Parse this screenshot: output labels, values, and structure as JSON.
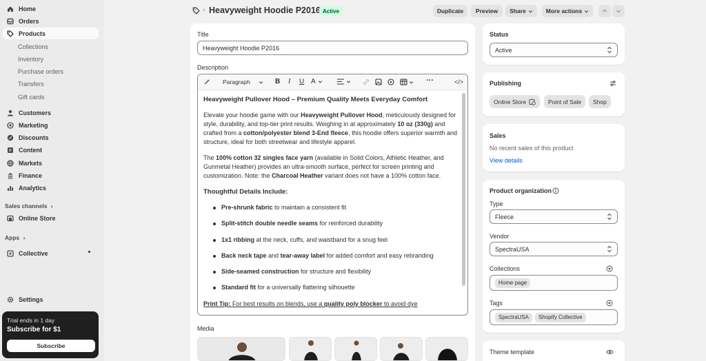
{
  "sidebar": {
    "items": [
      {
        "label": "Home",
        "icon": "home-icon"
      },
      {
        "label": "Orders",
        "icon": "orders-icon"
      },
      {
        "label": "Products",
        "icon": "tag-icon"
      },
      {
        "label": "Customers",
        "icon": "person-icon"
      },
      {
        "label": "Marketing",
        "icon": "target-icon"
      },
      {
        "label": "Discounts",
        "icon": "discount-icon"
      },
      {
        "label": "Content",
        "icon": "content-icon"
      },
      {
        "label": "Markets",
        "icon": "globe-icon"
      },
      {
        "label": "Finance",
        "icon": "bank-icon"
      },
      {
        "label": "Analytics",
        "icon": "chart-icon"
      }
    ],
    "product_subitems": [
      "Collections",
      "Inventory",
      "Purchase orders",
      "Transfers",
      "Gift cards"
    ],
    "sales_channels_label": "Sales channels",
    "online_store_label": "Online Store",
    "apps_label": "Apps",
    "collective_label": "Collective",
    "settings_label": "Settings",
    "trial": {
      "line1": "Trial ends in 1 day",
      "line2": "Subscribe for $1",
      "button": "Subscribe"
    }
  },
  "header": {
    "title": "Heavyweight Hoodie P2016",
    "status_badge": "Active",
    "buttons": {
      "duplicate": "Duplicate",
      "preview": "Preview",
      "share": "Share",
      "more": "More actions"
    }
  },
  "product": {
    "title_label": "Title",
    "title_value": "Heavyweight Hoodie P2016",
    "description_label": "Description",
    "toolbar": {
      "paragraph": "Paragraph"
    },
    "description": {
      "heading": "Heavyweight Pullover Hood – Premium Quality Meets Everyday Comfort",
      "p1": [
        {
          "t": "Elevate your hoodie game with our ",
          "b": false
        },
        {
          "t": "Heavyweight Pullover Hood",
          "b": true
        },
        {
          "t": ", meticulously designed for style, durability, and top-tier print results. Weighing in at approximately ",
          "b": false
        },
        {
          "t": "10 oz (330g)",
          "b": true
        },
        {
          "t": " and crafted from a ",
          "b": false
        },
        {
          "t": "cotton/polyester blend 3-End fleece",
          "b": true
        },
        {
          "t": ", this hoodie offers superior warmth and structure, ideal for both streetwear and lifestyle apparel.",
          "b": false
        }
      ],
      "p2": [
        {
          "t": "The ",
          "b": false
        },
        {
          "t": "100% cotton 32 singles face yarn",
          "b": true
        },
        {
          "t": " (available in Solid Colors, Athletic Heather, and Gunmetal Heather) provides an ultra-smooth surface, perfect for screen printing and customization. Note: the ",
          "b": false
        },
        {
          "t": "Charcoal Heather",
          "b": true
        },
        {
          "t": " variant does not have a 100% cotton face.",
          "b": false
        }
      ],
      "details_heading": "Thoughtful Details Include:",
      "bullets": [
        [
          {
            "t": "Pre-shrunk fabric",
            "b": true
          },
          {
            "t": " to maintain a consistent fit",
            "b": false
          }
        ],
        [
          {
            "t": "Split-stitch double needle seams",
            "b": true
          },
          {
            "t": " for reinforced durability",
            "b": false
          }
        ],
        [
          {
            "t": "1x1 ribbing",
            "b": true
          },
          {
            "t": " at the neck, cuffs, and waistband for a snug feel",
            "b": false
          }
        ],
        [
          {
            "t": "Back neck tape",
            "b": true
          },
          {
            "t": " and ",
            "b": false
          },
          {
            "t": "tear-away label",
            "b": true
          },
          {
            "t": " for added comfort and easy rebranding",
            "b": false
          }
        ],
        [
          {
            "t": "Side-seamed construction",
            "b": true
          },
          {
            "t": " for structure and flexibility",
            "b": false
          }
        ],
        [
          {
            "t": "Standard fit",
            "b": true
          },
          {
            "t": " for a universally flattering silhouette",
            "b": false
          }
        ]
      ],
      "print_tip": [
        {
          "t": "Print Tip:",
          "b": true,
          "u": true
        },
        {
          "t": " For best results on blends, use a ",
          "b": false,
          "u": true
        },
        {
          "t": "quality poly blocker",
          "b": true,
          "u": true
        },
        {
          "t": " to avoid dye",
          "b": false,
          "u": true
        }
      ]
    },
    "media_label": "Media"
  },
  "right": {
    "status": {
      "label": "Status",
      "value": "Active"
    },
    "publishing": {
      "label": "Publishing",
      "channels": [
        "Online Store",
        "Point of Sale",
        "Shop"
      ]
    },
    "sales": {
      "label": "Sales",
      "text": "No recent sales of this product",
      "link": "View details"
    },
    "organization": {
      "label": "Product organization",
      "type_label": "Type",
      "type_value": "Fleece",
      "vendor_label": "Vendor",
      "vendor_value": "SpectraUSA",
      "collections_label": "Collections",
      "collections": [
        "Home page"
      ],
      "tags_label": "Tags",
      "tags": [
        "SpectraUSA",
        "Shopify Collective"
      ]
    },
    "theme_template_label": "Theme template"
  },
  "colors": {
    "accent_link": "#005bd3",
    "badge_bg": "#cdfee1",
    "badge_text": "#0c5132",
    "sidebar_bg": "#ebebeb",
    "page_bg": "#f1f1f1"
  }
}
